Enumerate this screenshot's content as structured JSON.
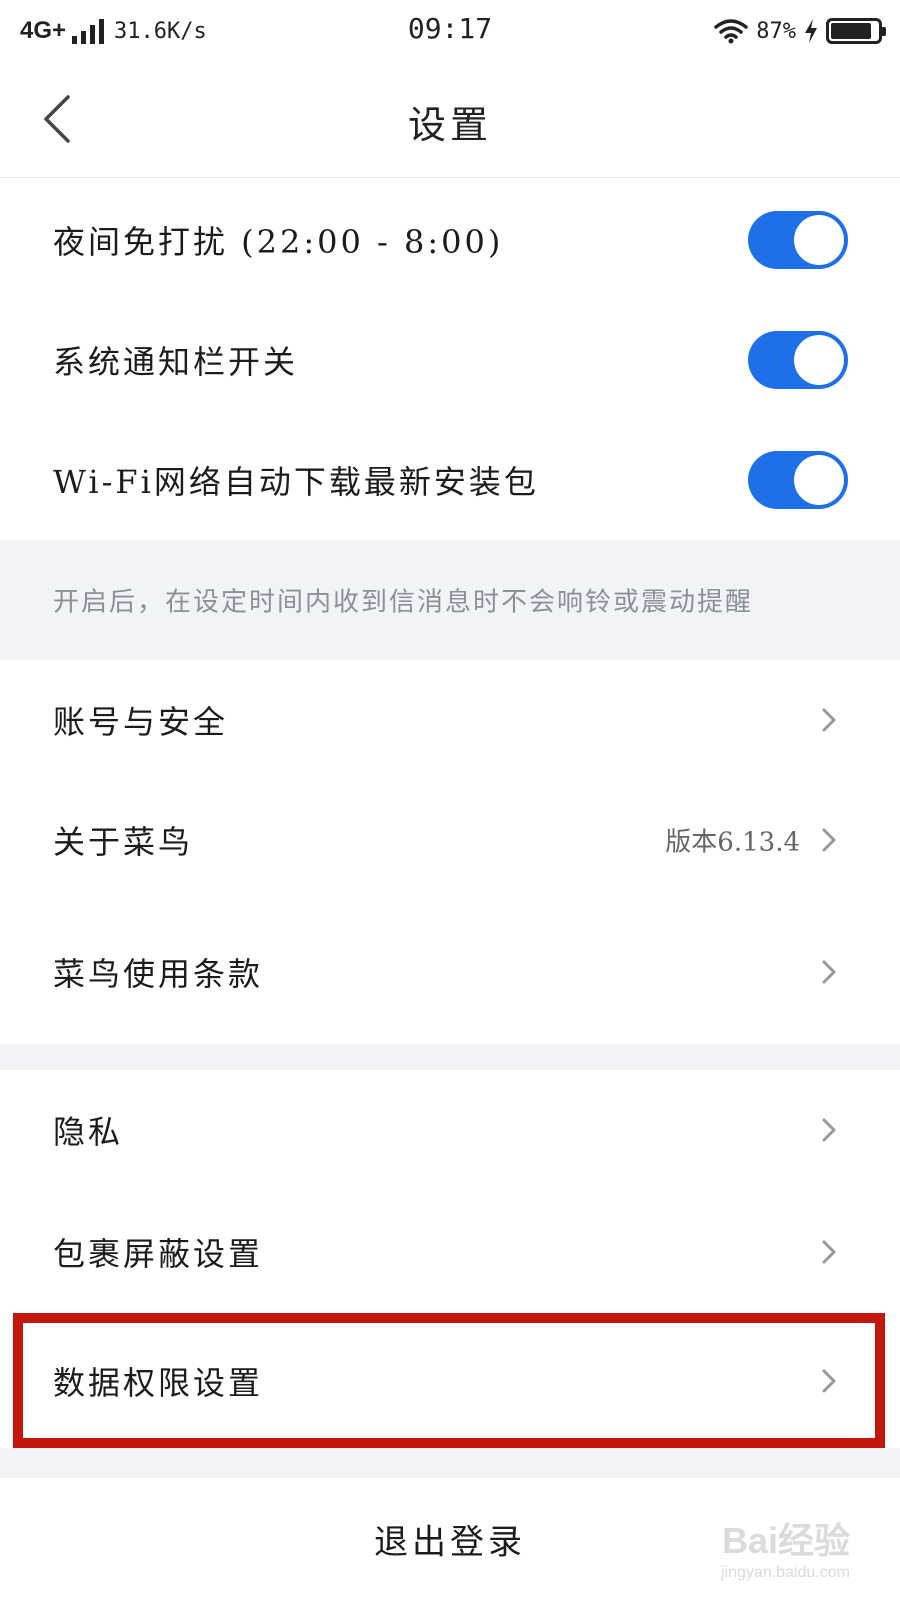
{
  "status_bar": {
    "network": "4G+",
    "speed": "31.6K/s",
    "time": "09:17",
    "battery": "87%",
    "battery_level": 0.87
  },
  "nav": {
    "title": "设置"
  },
  "toggles": [
    {
      "label": "夜间免打扰 (22:00 - 8:00)",
      "on": true
    },
    {
      "label": "系统通知栏开关",
      "on": true
    },
    {
      "label": "Wi-Fi网络自动下载最新安装包",
      "on": true
    }
  ],
  "note": "开启后，在设定时间内收到信消息时不会响铃或震动提醒",
  "menu_group1": [
    {
      "label": "账号与安全"
    },
    {
      "label": "关于菜鸟",
      "value": "版本6.13.4"
    },
    {
      "label": "菜鸟使用条款"
    }
  ],
  "menu_group2": [
    {
      "label": "隐私"
    },
    {
      "label": "包裹屏蔽设置"
    },
    {
      "label": "数据权限设置"
    }
  ],
  "logout_label": "退出登录",
  "watermark": {
    "logo": "Bai经验",
    "sub": "jingyan.baidu.com"
  },
  "colors": {
    "accent": "#1f6fe8",
    "highlight": "#c4170c",
    "section_bg": "#f1f3f7"
  }
}
